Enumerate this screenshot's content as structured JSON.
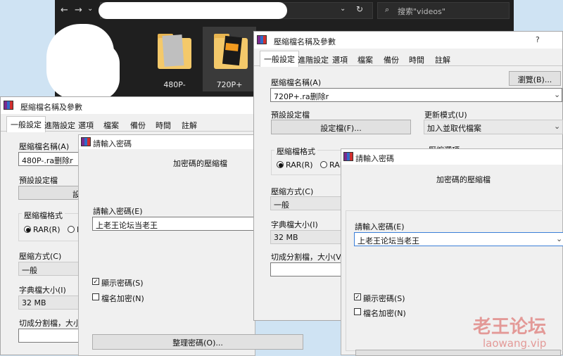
{
  "explorer": {
    "search_placeholder": "搜索\"videos\"",
    "folders": [
      {
        "label": "480P-"
      },
      {
        "label": "720P+"
      }
    ]
  },
  "dialog_left": {
    "title": "壓縮檔名稱及參數",
    "tabs": [
      "一般設定",
      "進階設定",
      "選項",
      "檔案",
      "備份",
      "時間",
      "註解"
    ],
    "archive_name_label": "壓縮檔名稱(A)",
    "archive_name_value": "480P-.ra删除r",
    "profile_label": "預設設定檔",
    "profile_button": "設",
    "format_group_label": "壓縮檔格式",
    "format_rar": "RAR(R)",
    "format_r": "R",
    "method_label": "壓縮方式(C)",
    "method_value": "一般",
    "dict_label": "字典檔大小(I)",
    "dict_value": "32 MB",
    "split_label": "切成分割檔，大小(",
    "password_dialog": {
      "title": "請輸入密碼",
      "heading": "加密碼的壓縮檔",
      "password_label": "請輸入密碼(E)",
      "password_value": "上老王论坛当老王",
      "show_password": "顯示密碼(S)",
      "encrypt_names": "檔名加密(N)",
      "organize_button": "整理密碼(O)..."
    }
  },
  "dialog_right": {
    "title": "壓縮檔名稱及參數",
    "help": "?",
    "tabs": [
      "一般設定",
      "進階設定",
      "選項",
      "檔案",
      "備份",
      "時間",
      "註解"
    ],
    "archive_name_label": "壓縮檔名稱(A)",
    "browse_button": "瀏覽(B)...",
    "archive_name_value": "720P+.ra删除r",
    "profile_label": "預設設定檔",
    "profile_button": "設定檔(F)...",
    "update_mode_label": "更新模式(U)",
    "update_mode_value": "加入並取代檔案",
    "format_group_label": "壓縮檔格式",
    "format_rar": "RAR(R)",
    "format_rar4": "RAR",
    "options_label": "壓縮選項",
    "method_label": "壓縮方式(C)",
    "method_value": "一般",
    "dict_label": "字典檔大小(I)",
    "dict_value": "32 MB",
    "split_label": "切成分割檔，大小(V)",
    "password_dialog": {
      "title": "請輸入密碼",
      "heading": "加密碼的壓縮檔",
      "password_label": "請輸入密碼(E)",
      "password_value": "上老王论坛当老王",
      "show_password": "顯示密碼(S)",
      "encrypt_names": "檔名加密(N)"
    }
  },
  "watermark": {
    "text_cn": "老王论坛",
    "text_url": "laowang.vip"
  }
}
